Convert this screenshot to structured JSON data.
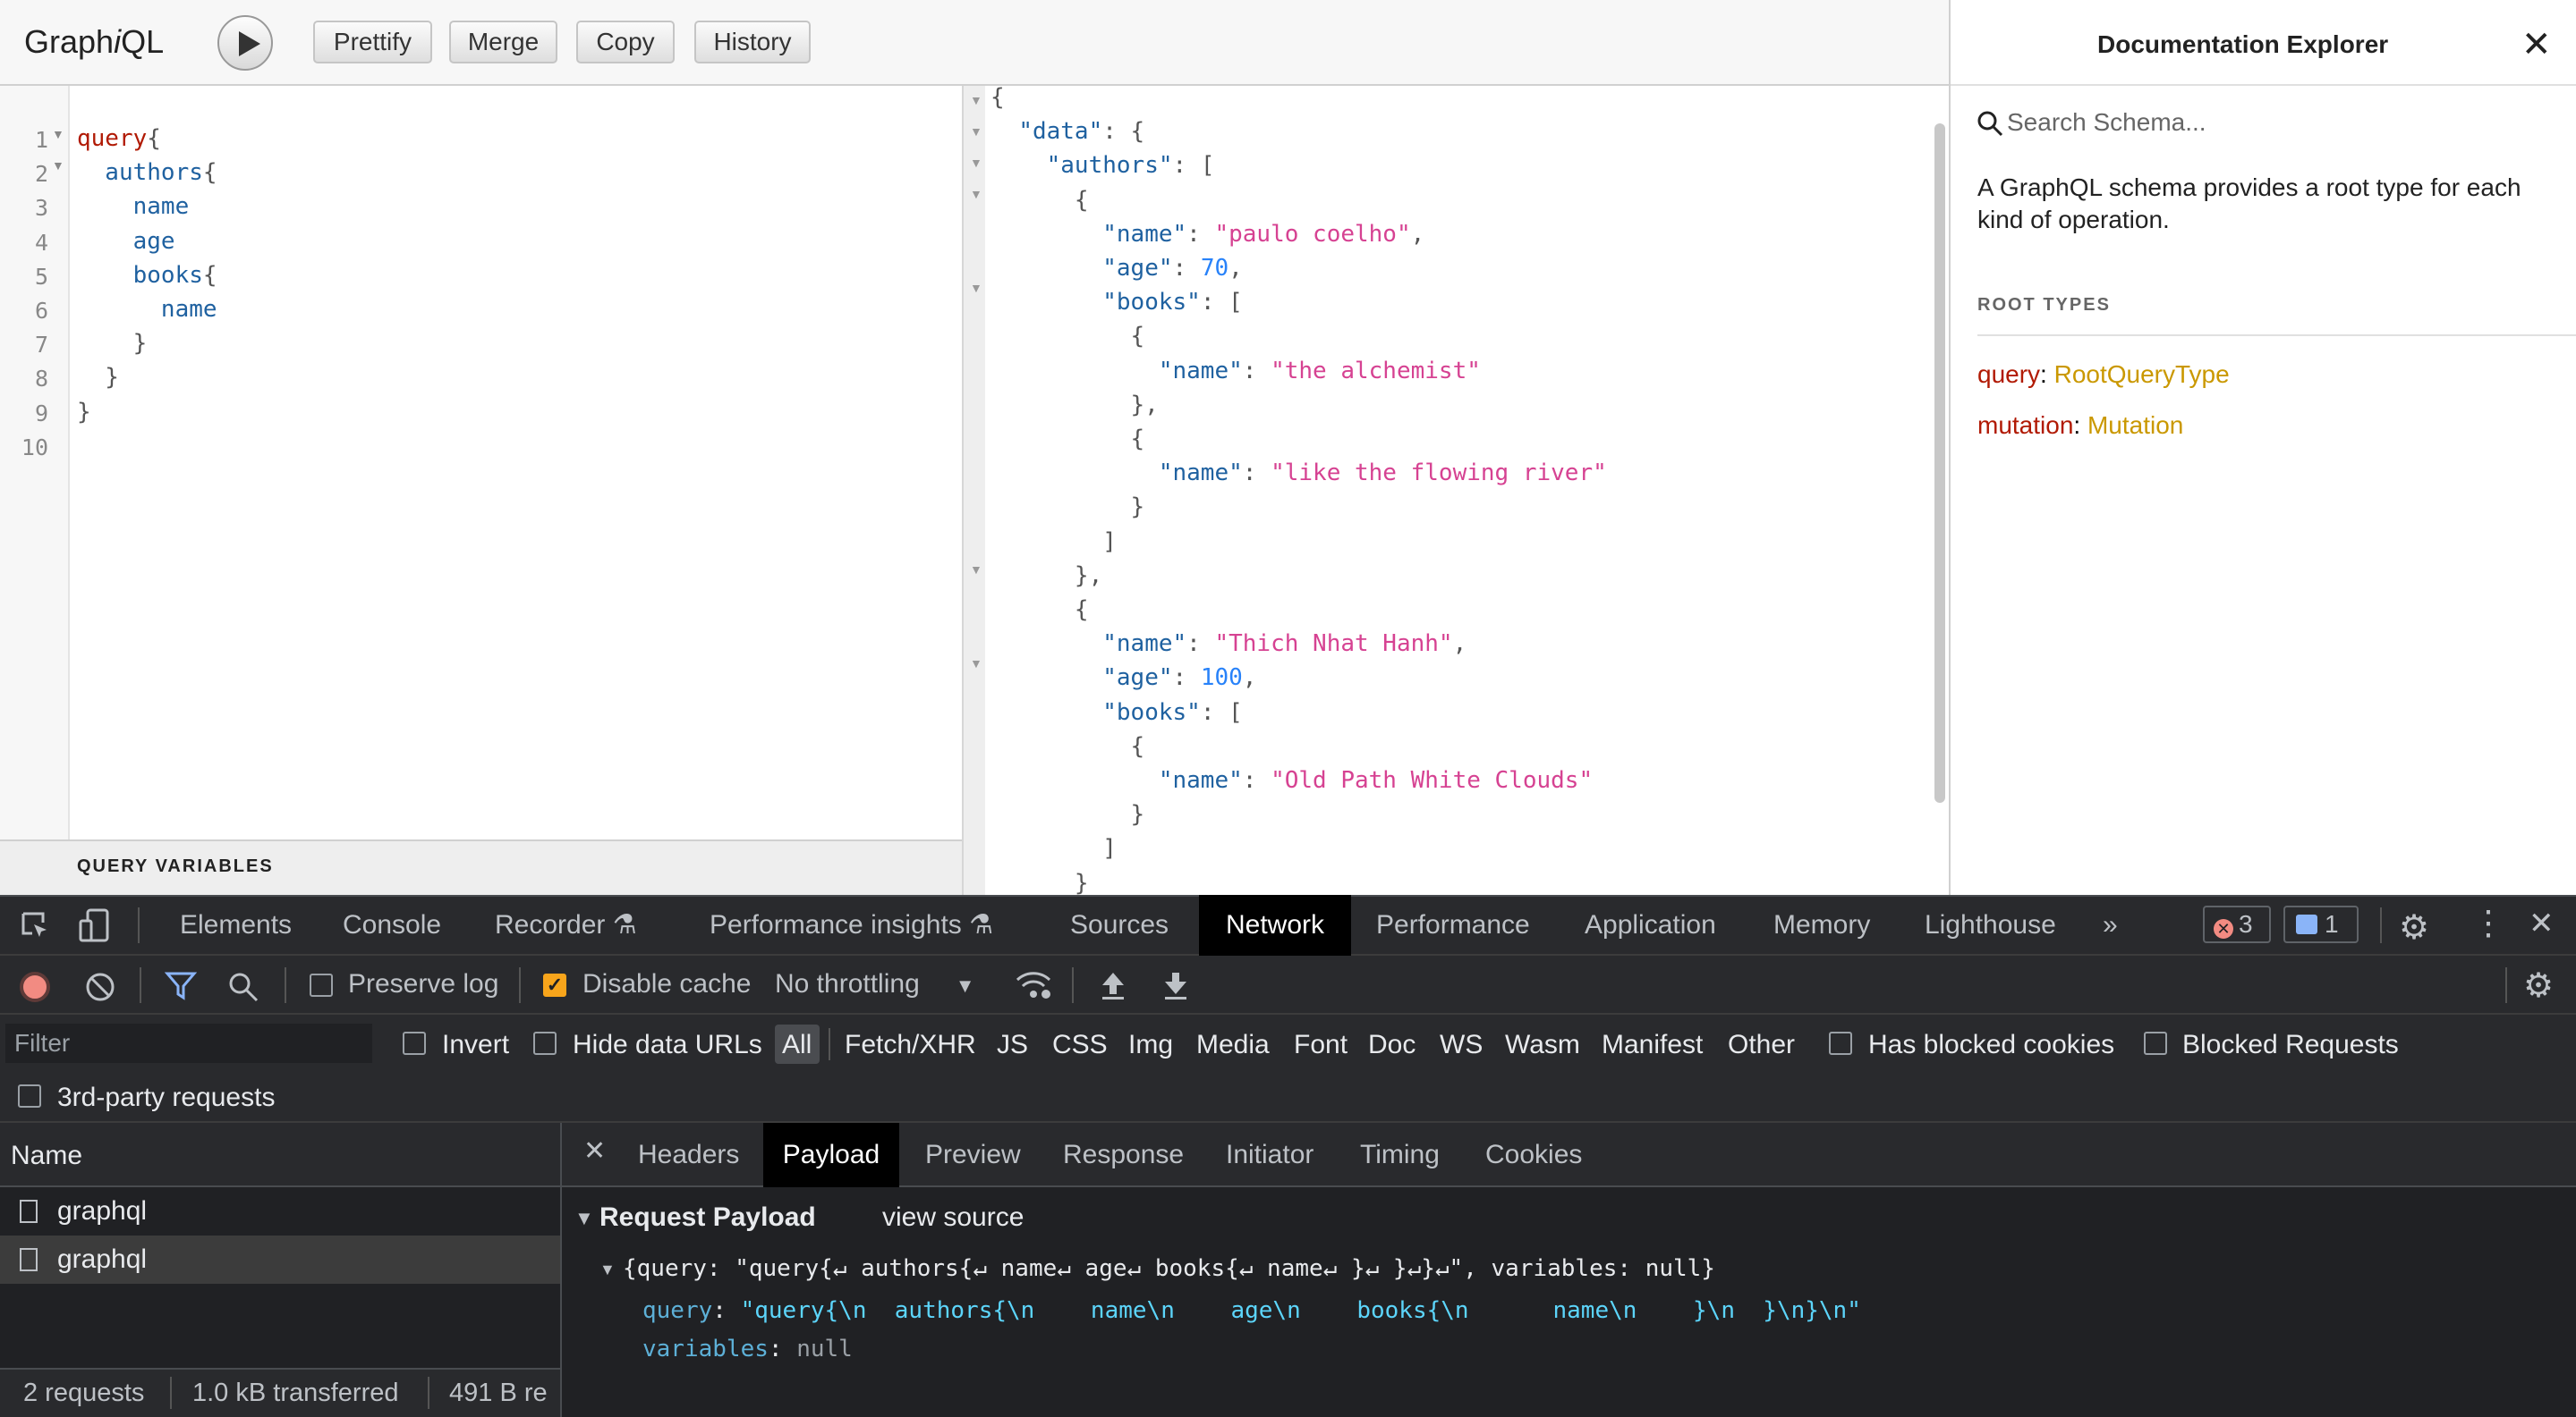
{
  "graphiql": {
    "logo_prefix": "Graph",
    "logo_i": "i",
    "logo_suffix": "QL",
    "buttons": {
      "prettify": "Prettify",
      "merge": "Merge",
      "copy": "Copy",
      "history": "History"
    },
    "query_variables_label": "QUERY VARIABLES",
    "line_numbers": [
      "1",
      "2",
      "3",
      "4",
      "5",
      "6",
      "7",
      "8",
      "9",
      "10"
    ],
    "query_lines": [
      [
        {
          "t": "query",
          "c": "kw"
        },
        {
          "t": "{",
          "c": "pn"
        }
      ],
      [
        {
          "t": "  authors",
          "c": "fd"
        },
        {
          "t": "{",
          "c": "pn"
        }
      ],
      [
        {
          "t": "    name",
          "c": "fd"
        }
      ],
      [
        {
          "t": "    age",
          "c": "fd"
        }
      ],
      [
        {
          "t": "    books",
          "c": "fd"
        },
        {
          "t": "{",
          "c": "pn"
        }
      ],
      [
        {
          "t": "      name",
          "c": "fd"
        }
      ],
      [
        {
          "t": "    }",
          "c": "pn"
        }
      ],
      [
        {
          "t": "  }",
          "c": "pn"
        }
      ],
      [
        {
          "t": "}",
          "c": "pn"
        }
      ],
      []
    ],
    "result_lines": [
      [
        {
          "t": "{",
          "c": "pn"
        }
      ],
      [
        {
          "t": "  ",
          "c": "pn"
        },
        {
          "t": "\"data\"",
          "c": "rk"
        },
        {
          "t": ": {",
          "c": "pn"
        }
      ],
      [
        {
          "t": "    ",
          "c": "pn"
        },
        {
          "t": "\"authors\"",
          "c": "rk"
        },
        {
          "t": ": [",
          "c": "pn"
        }
      ],
      [
        {
          "t": "      {",
          "c": "pn"
        }
      ],
      [
        {
          "t": "        ",
          "c": "pn"
        },
        {
          "t": "\"name\"",
          "c": "rk"
        },
        {
          "t": ": ",
          "c": "pn"
        },
        {
          "t": "\"paulo coelho\"",
          "c": "rs"
        },
        {
          "t": ",",
          "c": "pn"
        }
      ],
      [
        {
          "t": "        ",
          "c": "pn"
        },
        {
          "t": "\"age\"",
          "c": "rk"
        },
        {
          "t": ": ",
          "c": "pn"
        },
        {
          "t": "70",
          "c": "rn"
        },
        {
          "t": ",",
          "c": "pn"
        }
      ],
      [
        {
          "t": "        ",
          "c": "pn"
        },
        {
          "t": "\"books\"",
          "c": "rk"
        },
        {
          "t": ": [",
          "c": "pn"
        }
      ],
      [
        {
          "t": "          {",
          "c": "pn"
        }
      ],
      [
        {
          "t": "            ",
          "c": "pn"
        },
        {
          "t": "\"name\"",
          "c": "rk"
        },
        {
          "t": ": ",
          "c": "pn"
        },
        {
          "t": "\"the alchemist\"",
          "c": "rs"
        }
      ],
      [
        {
          "t": "          },",
          "c": "pn"
        }
      ],
      [
        {
          "t": "          {",
          "c": "pn"
        }
      ],
      [
        {
          "t": "            ",
          "c": "pn"
        },
        {
          "t": "\"name\"",
          "c": "rk"
        },
        {
          "t": ": ",
          "c": "pn"
        },
        {
          "t": "\"like the flowing river\"",
          "c": "rs"
        }
      ],
      [
        {
          "t": "          }",
          "c": "pn"
        }
      ],
      [
        {
          "t": "        ]",
          "c": "pn"
        }
      ],
      [
        {
          "t": "      },",
          "c": "pn"
        }
      ],
      [
        {
          "t": "      {",
          "c": "pn"
        }
      ],
      [
        {
          "t": "        ",
          "c": "pn"
        },
        {
          "t": "\"name\"",
          "c": "rk"
        },
        {
          "t": ": ",
          "c": "pn"
        },
        {
          "t": "\"Thich Nhat Hanh\"",
          "c": "rs"
        },
        {
          "t": ",",
          "c": "pn"
        }
      ],
      [
        {
          "t": "        ",
          "c": "pn"
        },
        {
          "t": "\"age\"",
          "c": "rk"
        },
        {
          "t": ": ",
          "c": "pn"
        },
        {
          "t": "100",
          "c": "rn"
        },
        {
          "t": ",",
          "c": "pn"
        }
      ],
      [
        {
          "t": "        ",
          "c": "pn"
        },
        {
          "t": "\"books\"",
          "c": "rk"
        },
        {
          "t": ": [",
          "c": "pn"
        }
      ],
      [
        {
          "t": "          {",
          "c": "pn"
        }
      ],
      [
        {
          "t": "            ",
          "c": "pn"
        },
        {
          "t": "\"name\"",
          "c": "rk"
        },
        {
          "t": ": ",
          "c": "pn"
        },
        {
          "t": "\"Old Path White Clouds\"",
          "c": "rs"
        }
      ],
      [
        {
          "t": "          }",
          "c": "pn"
        }
      ],
      [
        {
          "t": "        ]",
          "c": "pn"
        }
      ],
      [
        {
          "t": "      }",
          "c": "pn"
        }
      ],
      [
        {
          "t": "    ]",
          "c": "pn"
        }
      ],
      [
        {
          "t": "  }",
          "c": "pn"
        }
      ]
    ]
  },
  "docs": {
    "title": "Documentation Explorer",
    "search_placeholder": "Search Schema...",
    "description": "A GraphQL schema provides a root type for each kind of operation.",
    "root_types_label": "ROOT TYPES",
    "root_types": [
      {
        "key": "query",
        "sep": ": ",
        "value": "RootQueryType"
      },
      {
        "key": "mutation",
        "sep": ": ",
        "value": "Mutation"
      }
    ]
  },
  "devtools": {
    "tabs": {
      "elements": "Elements",
      "console": "Console",
      "recorder": "Recorder",
      "perf_insights": "Performance insights",
      "sources": "Sources",
      "network": "Network",
      "performance": "Performance",
      "application": "Application",
      "memory": "Memory",
      "lighthouse": "Lighthouse",
      "more": "»"
    },
    "error_count": "3",
    "message_count": "1",
    "toolbar": {
      "preserve_log": "Preserve log",
      "disable_cache": "Disable cache",
      "throttling": "No throttling"
    },
    "filter": {
      "placeholder": "Filter",
      "invert": "Invert",
      "hide_data_urls": "Hide data URLs",
      "types": [
        "All",
        "Fetch/XHR",
        "JS",
        "CSS",
        "Img",
        "Media",
        "Font",
        "Doc",
        "WS",
        "Wasm",
        "Manifest",
        "Other"
      ],
      "has_blocked_cookies": "Has blocked cookies",
      "blocked_requests": "Blocked Requests",
      "third_party": "3rd-party requests"
    },
    "requests": {
      "name_header": "Name",
      "items": [
        "graphql",
        "graphql"
      ],
      "status": {
        "count": "2 requests",
        "transferred": "1.0 kB transferred",
        "resources": "491 B re"
      }
    },
    "detail_tabs": {
      "headers": "Headers",
      "payload": "Payload",
      "preview": "Preview",
      "response": "Response",
      "initiator": "Initiator",
      "timing": "Timing",
      "cookies": "Cookies"
    },
    "payload": {
      "section_title": "Request Payload",
      "view_source": "view source",
      "summary": "{query: \"query{↵ authors{↵ name↵ age↵ books{↵ name↵ }↵ }↵}↵\", variables: null}",
      "query_key": "query",
      "query_value": "\"query{\\n  authors{\\n    name\\n    age\\n    books{\\n      name\\n    }\\n  }\\n}\\n\"",
      "variables_key": "variables",
      "variables_value": "null"
    }
  }
}
